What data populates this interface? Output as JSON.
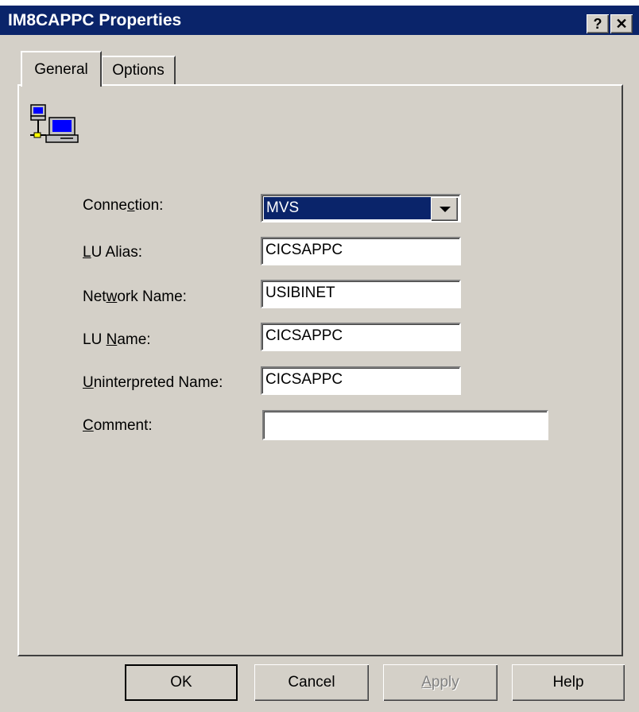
{
  "window": {
    "title": "IM8CAPPC Properties",
    "help_button": "?",
    "close_button": "✕"
  },
  "tabs": [
    {
      "label": "General",
      "selected": true
    },
    {
      "label": "Options",
      "selected": false
    }
  ],
  "icon": "network-computer-icon",
  "form": {
    "connection": {
      "label_pre": "Conne",
      "label_mn": "c",
      "label_post": "tion:",
      "value": "MVS"
    },
    "lu_alias": {
      "label_pre": "",
      "label_mn": "L",
      "label_post": "U Alias:",
      "value": "CICSAPPC"
    },
    "network_name": {
      "label_pre": "Net",
      "label_mn": "w",
      "label_post": "ork Name:",
      "value": "USIBINET"
    },
    "lu_name": {
      "label_pre": "LU ",
      "label_mn": "N",
      "label_post": "ame:",
      "value": "CICSAPPC"
    },
    "uninterpreted_name": {
      "label_pre": "",
      "label_mn": "U",
      "label_post": "ninterpreted Name:",
      "value": "CICSAPPC"
    },
    "comment": {
      "label_pre": "",
      "label_mn": "C",
      "label_post": "omment:",
      "value": ""
    }
  },
  "buttons": {
    "ok": "OK",
    "cancel": "Cancel",
    "apply_mn": "A",
    "apply_rest": "pply",
    "help": "Help"
  },
  "colors": {
    "title_bar": "#0a246a",
    "face": "#d4d0c8",
    "selection": "#0a246a"
  }
}
